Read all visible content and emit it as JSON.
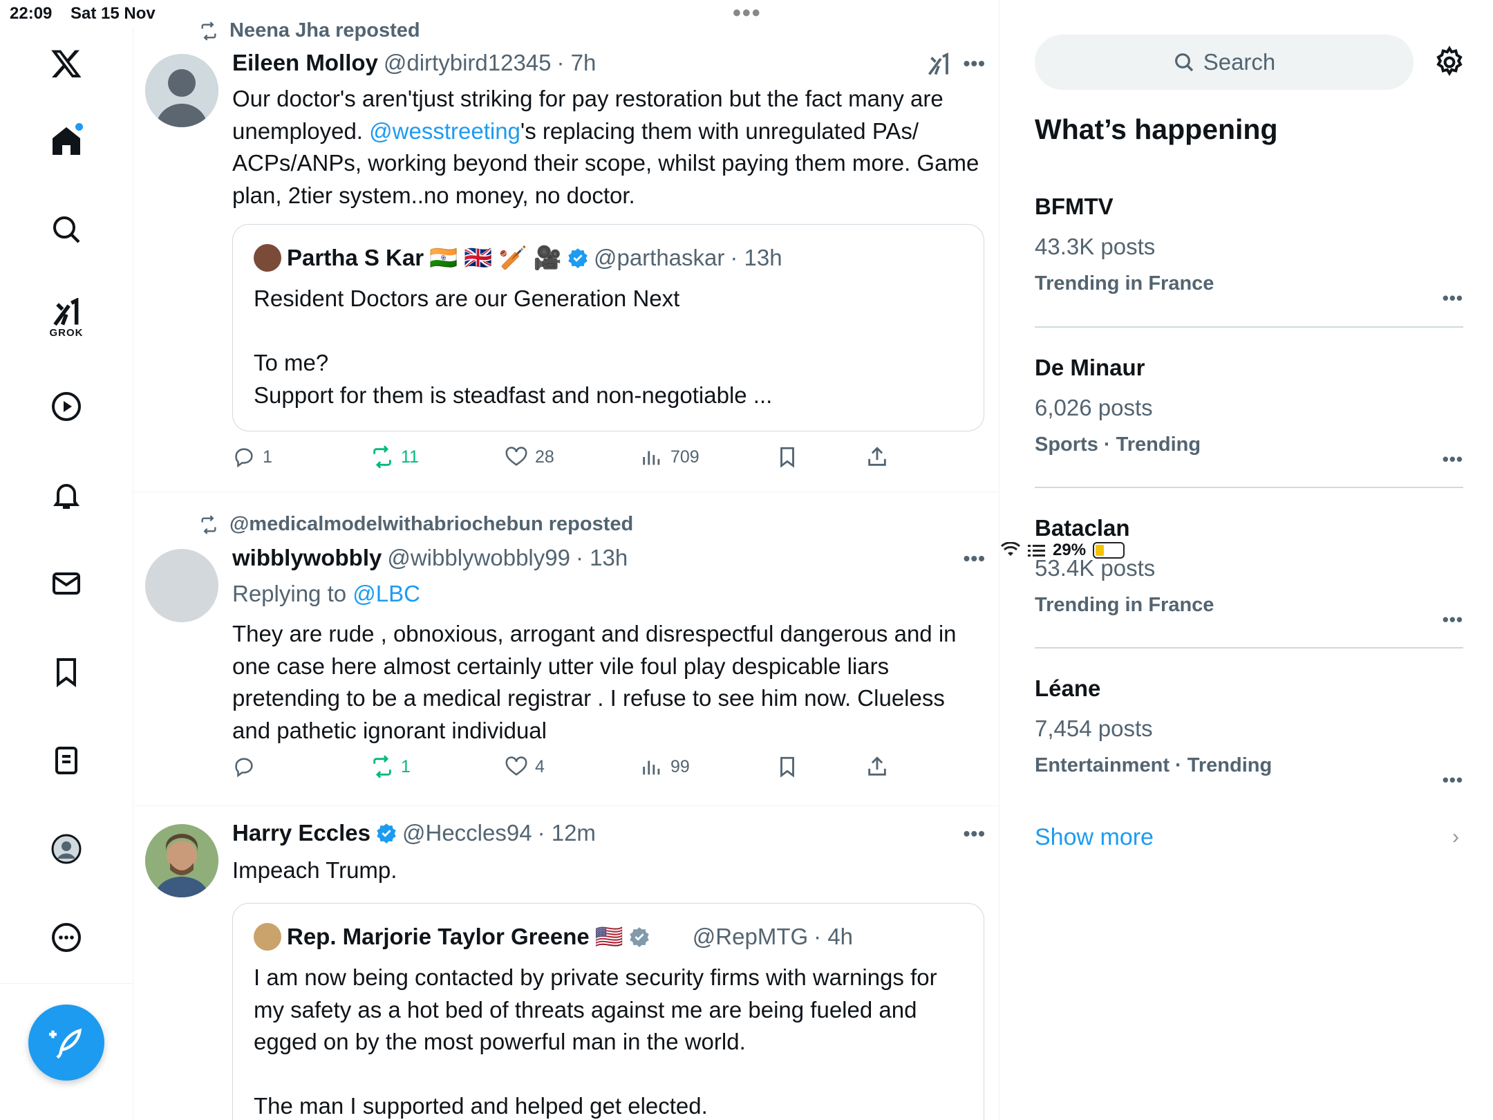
{
  "status": {
    "time": "22:09",
    "date": "Sat 15 Nov",
    "battery": "29%"
  },
  "nav": {
    "items": [
      "X logo",
      "Home",
      "Search",
      "Grok",
      "Videos",
      "Notifications",
      "Messages",
      "Bookmarks",
      "Lists",
      "Profile",
      "More"
    ],
    "grok_label": "GROK"
  },
  "posts": [
    {
      "repost_by": "Neena Jha reposted",
      "name": "Eileen Molloy",
      "handle": "@dirtybird12345",
      "time": "· 7h",
      "text_parts": [
        "Our doctor's aren'tjust striking for pay restoration but the fact  many are unemployed. ",
        "@wesstreeting",
        "'s replacing them with unregulated PAs/ ACPs/ANPs, working beyond their scope, whilst paying them more. Game plan, 2tier system..no money, no doctor."
      ],
      "quote": {
        "name": "Partha S Kar",
        "emojis": "🇮🇳 🇬🇧 🏏 🎥",
        "handle": "@parthaskar",
        "time": "· 13h",
        "lines": [
          "Resident Doctors are our Generation Next",
          "",
          "To me?",
          "Support for them is steadfast and non-negotiable ..."
        ]
      },
      "actions": {
        "replies": "1",
        "reposts": "11",
        "likes": "28",
        "views": "709"
      }
    },
    {
      "repost_by": "@medicalmodelwithabriochebun reposted",
      "name": "wibblywobbly",
      "handle": "@wibblywobbly99",
      "time": "· 13h",
      "replying_prefix": "Replying to ",
      "replying_to": "@LBC",
      "text": "They are rude , obnoxious, arrogant and disrespectful dangerous and in one case here almost certainly utter vile foul play despicable liars pretending to be a medical registrar . I refuse to see him now. Clueless and pathetic ignorant individual",
      "actions": {
        "replies": "",
        "reposts": "1",
        "likes": "4",
        "views": "99"
      }
    },
    {
      "name": "Harry Eccles",
      "handle": "@Heccles94",
      "time": "· 12m",
      "text": "Impeach Trump.",
      "quote": {
        "name": "Rep. Marjorie Taylor Greene",
        "emojis": "🇺🇸",
        "handle": "@RepMTG",
        "time": "· 4h",
        "lines": [
          "I am now being contacted by private security firms with warnings for my safety as a hot bed of threats against me are being fueled and egged on by the most powerful man in the world.",
          "",
          "The man I supported and helped get elected."
        ]
      }
    }
  ],
  "right": {
    "search_placeholder": "Search",
    "heading": "What’s happening",
    "trends": [
      {
        "name": "BFMTV",
        "posts": "43.3K posts",
        "context": "Trending in France"
      },
      {
        "name": "De Minaur",
        "posts": "6,026 posts",
        "context": "Sports · Trending"
      },
      {
        "name": "Bataclan",
        "posts": "53.4K posts",
        "context": "Trending in France"
      },
      {
        "name": "Léane",
        "posts": "7,454 posts",
        "context": "Entertainment · Trending"
      }
    ],
    "show_more": "Show more"
  },
  "colors": {
    "accent": "#1d9bf0",
    "repost_green": "#00ba7c",
    "muted": "#536471"
  }
}
